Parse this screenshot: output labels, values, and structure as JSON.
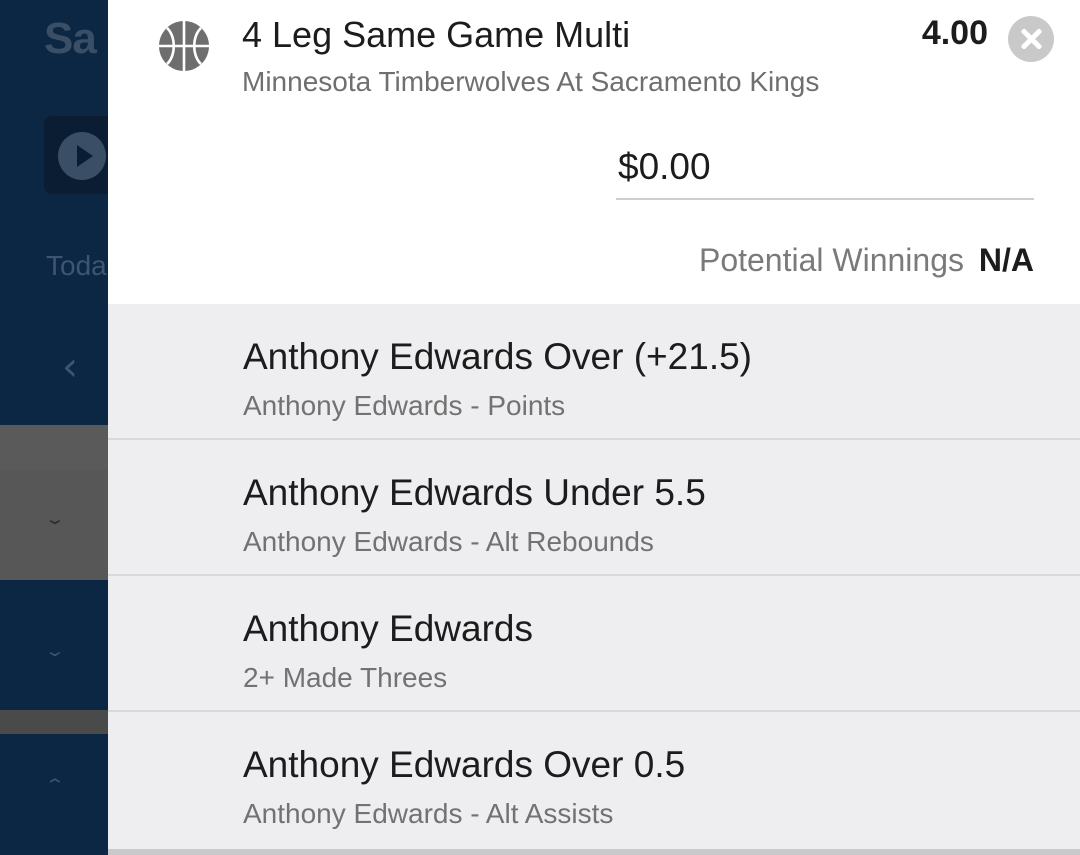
{
  "background": {
    "logo_text": "Sa",
    "today_text": "Toda",
    "back_glyph": "‹",
    "chevrons": [
      "⌄",
      "⌄",
      "⌃"
    ]
  },
  "bet": {
    "sport_icon": "basketball-icon",
    "title": "4 Leg Same Game Multi",
    "subtitle": "Minnesota Timberwolves At Sacramento Kings",
    "odds": "4.00",
    "stake_value": "$0.00",
    "potential_winnings_label": "Potential Winnings",
    "potential_winnings_value": "N/A"
  },
  "legs": [
    {
      "title": "Anthony Edwards Over (+21.5)",
      "subtitle": "Anthony Edwards - Points"
    },
    {
      "title": "Anthony Edwards Under 5.5",
      "subtitle": "Anthony Edwards - Alt Rebounds"
    },
    {
      "title": "Anthony Edwards",
      "subtitle": "2+ Made Threes"
    },
    {
      "title": "Anthony Edwards Over 0.5",
      "subtitle": "Anthony Edwards - Alt Assists"
    }
  ],
  "colors": {
    "overlay_bg": "#0b2744",
    "panel_bg": "#ffffff",
    "legs_bg": "#eeeef0",
    "close_button": "#c9c9c9"
  }
}
